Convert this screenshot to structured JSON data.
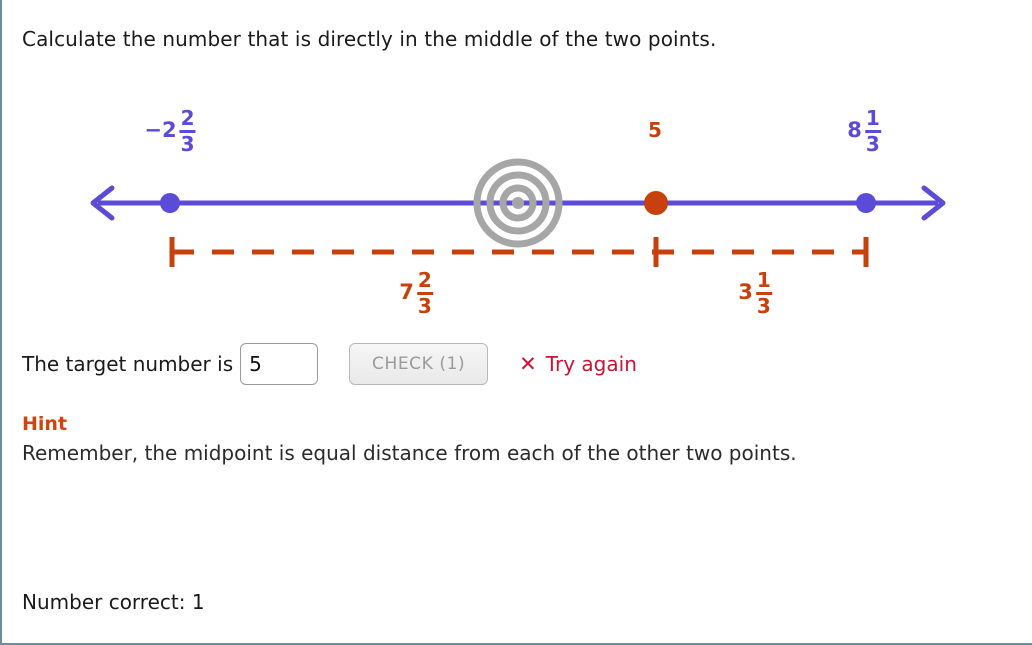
{
  "prompt": "Calculate the number that is directly in the middle of the two points.",
  "numberline": {
    "left_point": {
      "whole": "−2",
      "numerator": "2",
      "denominator": "3",
      "color": "#5b4bd6"
    },
    "right_point": {
      "whole": "8",
      "numerator": "1",
      "denominator": "3",
      "color": "#5b4bd6"
    },
    "guess_point": {
      "label": "5",
      "color": "#c8400c"
    },
    "distance_left": {
      "whole": "7",
      "numerator": "2",
      "denominator": "3",
      "color": "#c8400c"
    },
    "distance_right": {
      "whole": "3",
      "numerator": "1",
      "denominator": "3",
      "color": "#c8400c"
    },
    "line_color": "#5b4bd6",
    "dashed_color": "#c8400c",
    "target_color": "#a6a6a6"
  },
  "answer": {
    "label": "The target number is",
    "value": "5",
    "placeholder": "",
    "check_label": "CHECK (1)",
    "feedback_icon": "✕",
    "feedback_text": "Try again",
    "feedback_color": "#cc1337"
  },
  "hint": {
    "title": "Hint",
    "text": "Remember, the midpoint is equal distance from each of the other two points.",
    "title_color": "#d2440d"
  },
  "score": {
    "text": "Number correct: 1"
  }
}
